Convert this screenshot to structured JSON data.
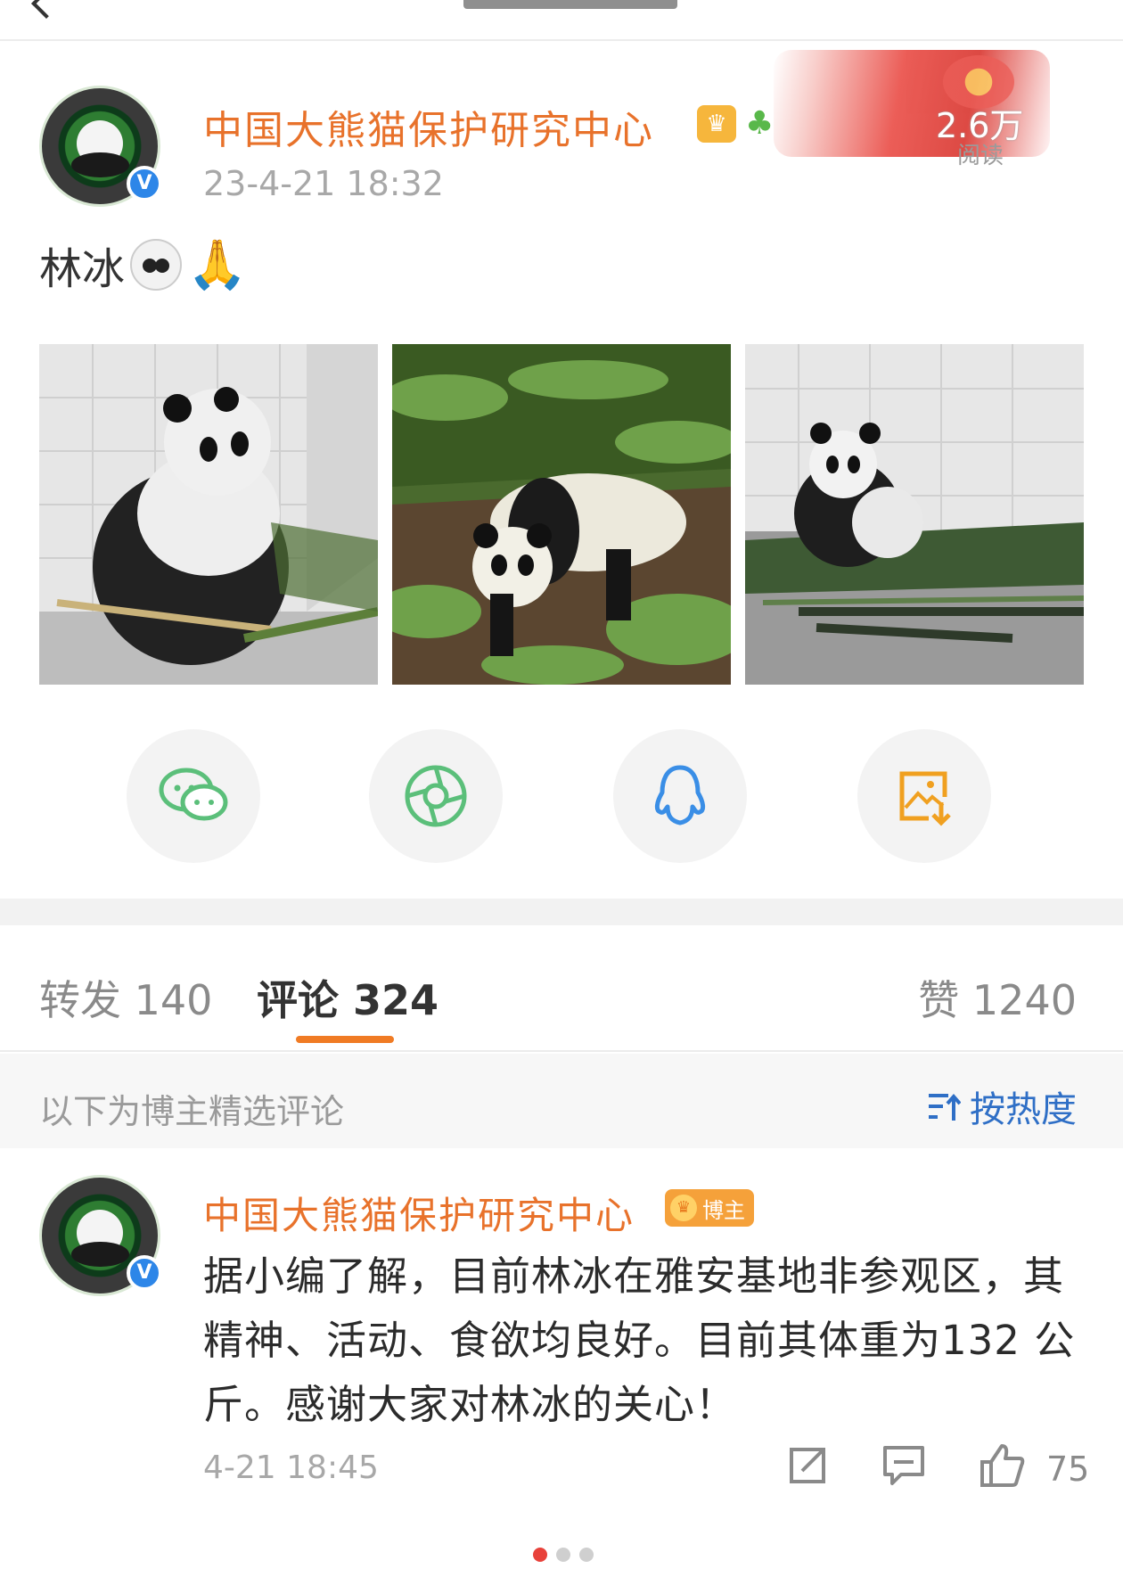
{
  "post": {
    "author_name": "中国大熊猫保护研究中心",
    "read_count": "2.6万",
    "read_label": "阅读",
    "time": "23-4-21 18:32",
    "text": "林冰"
  },
  "photos": [
    {
      "subject": "panda eating bamboo against tiled wall"
    },
    {
      "subject": "panda walking among ferns"
    },
    {
      "subject": "panda sitting on bamboo leaves"
    }
  ],
  "share": [
    {
      "name": "wechat",
      "color": "#5bbf7a"
    },
    {
      "name": "moments",
      "color": "#5bbf7a"
    },
    {
      "name": "qq",
      "color": "#3a8ee6"
    },
    {
      "name": "save-image",
      "color": "#f0a020"
    }
  ],
  "tabs": {
    "repost": "转发 140",
    "comment": "评论 324",
    "like": "赞 1240"
  },
  "comments_header": {
    "label": "以下为博主精选评论",
    "sort": "按热度"
  },
  "comment": {
    "author_name": "中国大熊猫保护研究中心",
    "badge": "博主",
    "text": "据小编了解，目前林冰在雅安基地非参观区，其精神、活动、食欲均良好。目前其体重为132 公斤。感谢大家对林冰的关心！",
    "time": "4-21 18:45",
    "like_count": "75"
  },
  "colors": {
    "accent_orange": "#e8722b",
    "link_blue": "#2f6fc6",
    "tab_indicator": "#f07b24"
  }
}
